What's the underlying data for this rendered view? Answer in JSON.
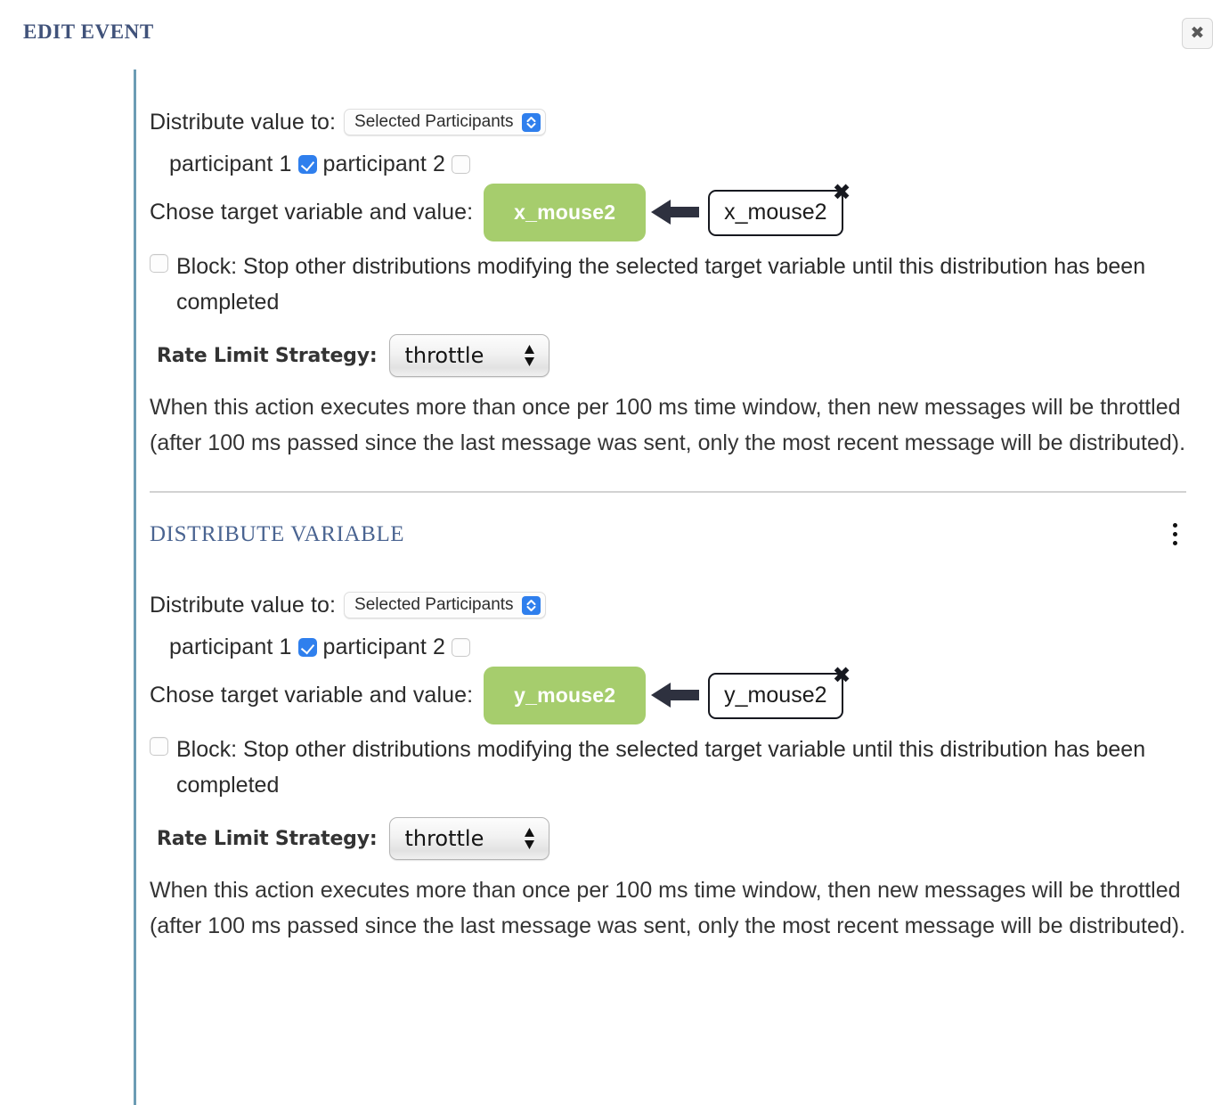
{
  "header": {
    "title": "EDIT EVENT",
    "close_label": "✖"
  },
  "colors": {
    "title_blue": "#40527a",
    "rail_blue": "#6c9cb4",
    "chip_green": "#a6cd6d",
    "accent_blue": "#2f7fed",
    "section_title_blue": "#4a6491",
    "divider_gray": "#d2d2d2"
  },
  "sections": [
    {
      "section_title": "",
      "distribute_label": "Distribute value to:",
      "distribute_value": "Selected Participants",
      "distribute_options": [
        "Selected Participants"
      ],
      "participants": [
        {
          "label": "participant 1",
          "checked": true
        },
        {
          "label": "participant 2",
          "checked": false
        }
      ],
      "target_label": "Chose target variable and value:",
      "target_chip": "x_mouse2",
      "arrow_icon": "arrow-left-icon",
      "target_value_box": "x_mouse2",
      "target_value_remove": "✖",
      "block_checked": false,
      "block_label": "Block: Stop other distributions modifying the selected target variable until this distribution has been completed",
      "rate_limit_label": "Rate Limit Strategy:",
      "rate_limit_value": "throttle",
      "rate_limit_options": [
        "throttle"
      ],
      "rate_limit_description": "When this action executes more than once per 100 ms time window, then new messages will be throttled (after 100 ms passed since the last message was sent, only the most recent message will be distributed)."
    },
    {
      "section_title": "DISTRIBUTE VARIABLE",
      "menu_icon": "kebab-menu-icon",
      "distribute_label": "Distribute value to:",
      "distribute_value": "Selected Participants",
      "distribute_options": [
        "Selected Participants"
      ],
      "participants": [
        {
          "label": "participant 1",
          "checked": true
        },
        {
          "label": "participant 2",
          "checked": false
        }
      ],
      "target_label": "Chose target variable and value:",
      "target_chip": "y_mouse2",
      "arrow_icon": "arrow-left-icon",
      "target_value_box": "y_mouse2",
      "target_value_remove": "✖",
      "block_checked": false,
      "block_label": "Block: Stop other distributions modifying the selected target variable until this distribution has been completed",
      "rate_limit_label": "Rate Limit Strategy:",
      "rate_limit_value": "throttle",
      "rate_limit_options": [
        "throttle"
      ],
      "rate_limit_description": "When this action executes more than once per 100 ms time window, then new messages will be throttled (after 100 ms passed since the last message was sent, only the most recent message will be distributed)."
    }
  ]
}
